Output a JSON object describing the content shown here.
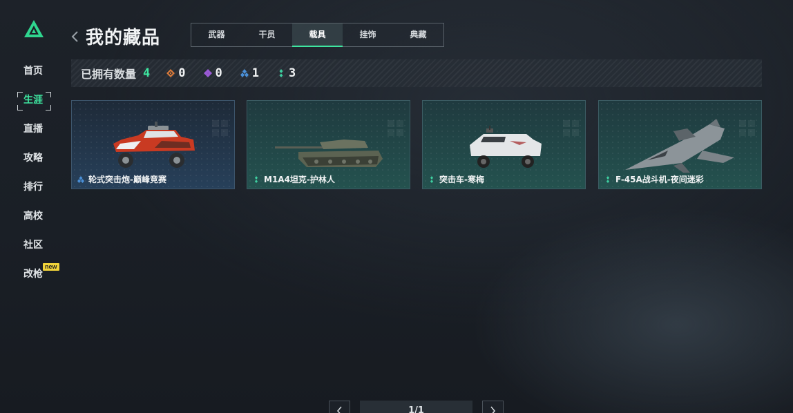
{
  "sidebar": {
    "items": [
      {
        "label": "首页"
      },
      {
        "label": "生涯"
      },
      {
        "label": "直播"
      },
      {
        "label": "攻略"
      },
      {
        "label": "排行"
      },
      {
        "label": "高校"
      },
      {
        "label": "社区"
      },
      {
        "label": "改枪"
      }
    ],
    "active_index": 1,
    "new_badge": "new"
  },
  "header": {
    "title": "我的藏品",
    "tabs": [
      {
        "label": "武器"
      },
      {
        "label": "干员"
      },
      {
        "label": "载具"
      },
      {
        "label": "挂饰"
      },
      {
        "label": "典藏"
      }
    ],
    "active_tab": 2
  },
  "stats": {
    "label": "已拥有数量",
    "total": "4",
    "counts": [
      {
        "icon": "orange-diamond-icon",
        "value": "0"
      },
      {
        "icon": "purple-diamond-icon",
        "value": "0"
      },
      {
        "icon": "blue-diamond-icon",
        "value": "1"
      },
      {
        "icon": "green-diamond-icon",
        "value": "3"
      }
    ]
  },
  "cards": [
    {
      "name": "轮式突击炮-巅峰竞赛",
      "rarity": "blue",
      "icon": "armored-car-icon"
    },
    {
      "name": "M1A4坦克-护林人",
      "rarity": "green",
      "icon": "tank-icon"
    },
    {
      "name": "突击车-寒梅",
      "rarity": "green",
      "icon": "assault-vehicle-icon"
    },
    {
      "name": "F-45A战斗机-夜间迷彩",
      "rarity": "green",
      "icon": "fighter-jet-icon"
    }
  ],
  "pagination": {
    "text": "1/1"
  },
  "colors": {
    "accent": "#3ee6a0",
    "blue_rarity": "#4a8fd6",
    "green_rarity": "#3ecfa0",
    "orange_rarity": "#d97a3a",
    "purple_rarity": "#9a5ad6"
  }
}
